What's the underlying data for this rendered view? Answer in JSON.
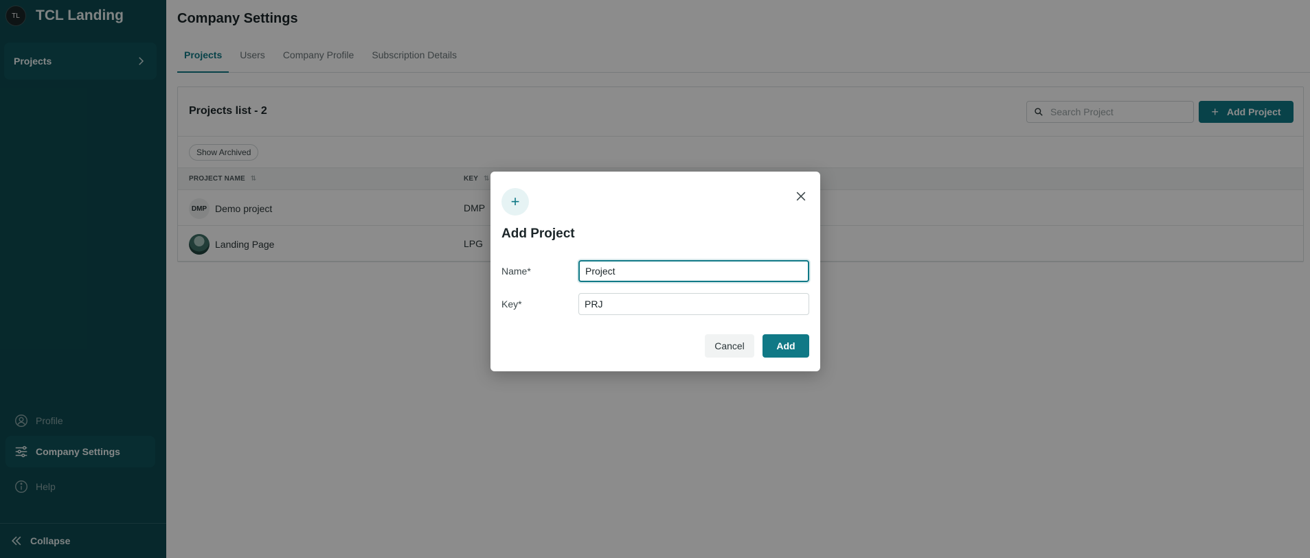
{
  "sidebar": {
    "brand_initials": "TL",
    "brand_name": "TCL Landing",
    "nav_projects": "Projects",
    "profile": "Profile",
    "company_settings": "Company Settings",
    "help": "Help",
    "collapse": "Collapse"
  },
  "page": {
    "title": "Company Settings",
    "tabs": [
      {
        "label": "Projects",
        "active": true
      },
      {
        "label": "Users",
        "active": false
      },
      {
        "label": "Company Profile",
        "active": false
      },
      {
        "label": "Subscription Details",
        "active": false
      }
    ]
  },
  "projects": {
    "title": "Projects list - 2",
    "search_placeholder": "Search Project",
    "add_button": "Add Project",
    "show_archived": "Show Archived",
    "columns": [
      "PROJECT NAME",
      "KEY"
    ],
    "rows": [
      {
        "avatar": "DMP",
        "name": "Demo project",
        "key": "DMP"
      },
      {
        "avatar": "",
        "name": "Landing Page",
        "key": "LPG"
      }
    ]
  },
  "modal": {
    "title": "Add Project",
    "name_label": "Name*",
    "name_value": "Project",
    "key_label": "Key*",
    "key_value": "PRJ",
    "cancel": "Cancel",
    "add": "Add"
  },
  "colors": {
    "sidebar_bg": "#0d4a50",
    "accent": "#107986"
  }
}
